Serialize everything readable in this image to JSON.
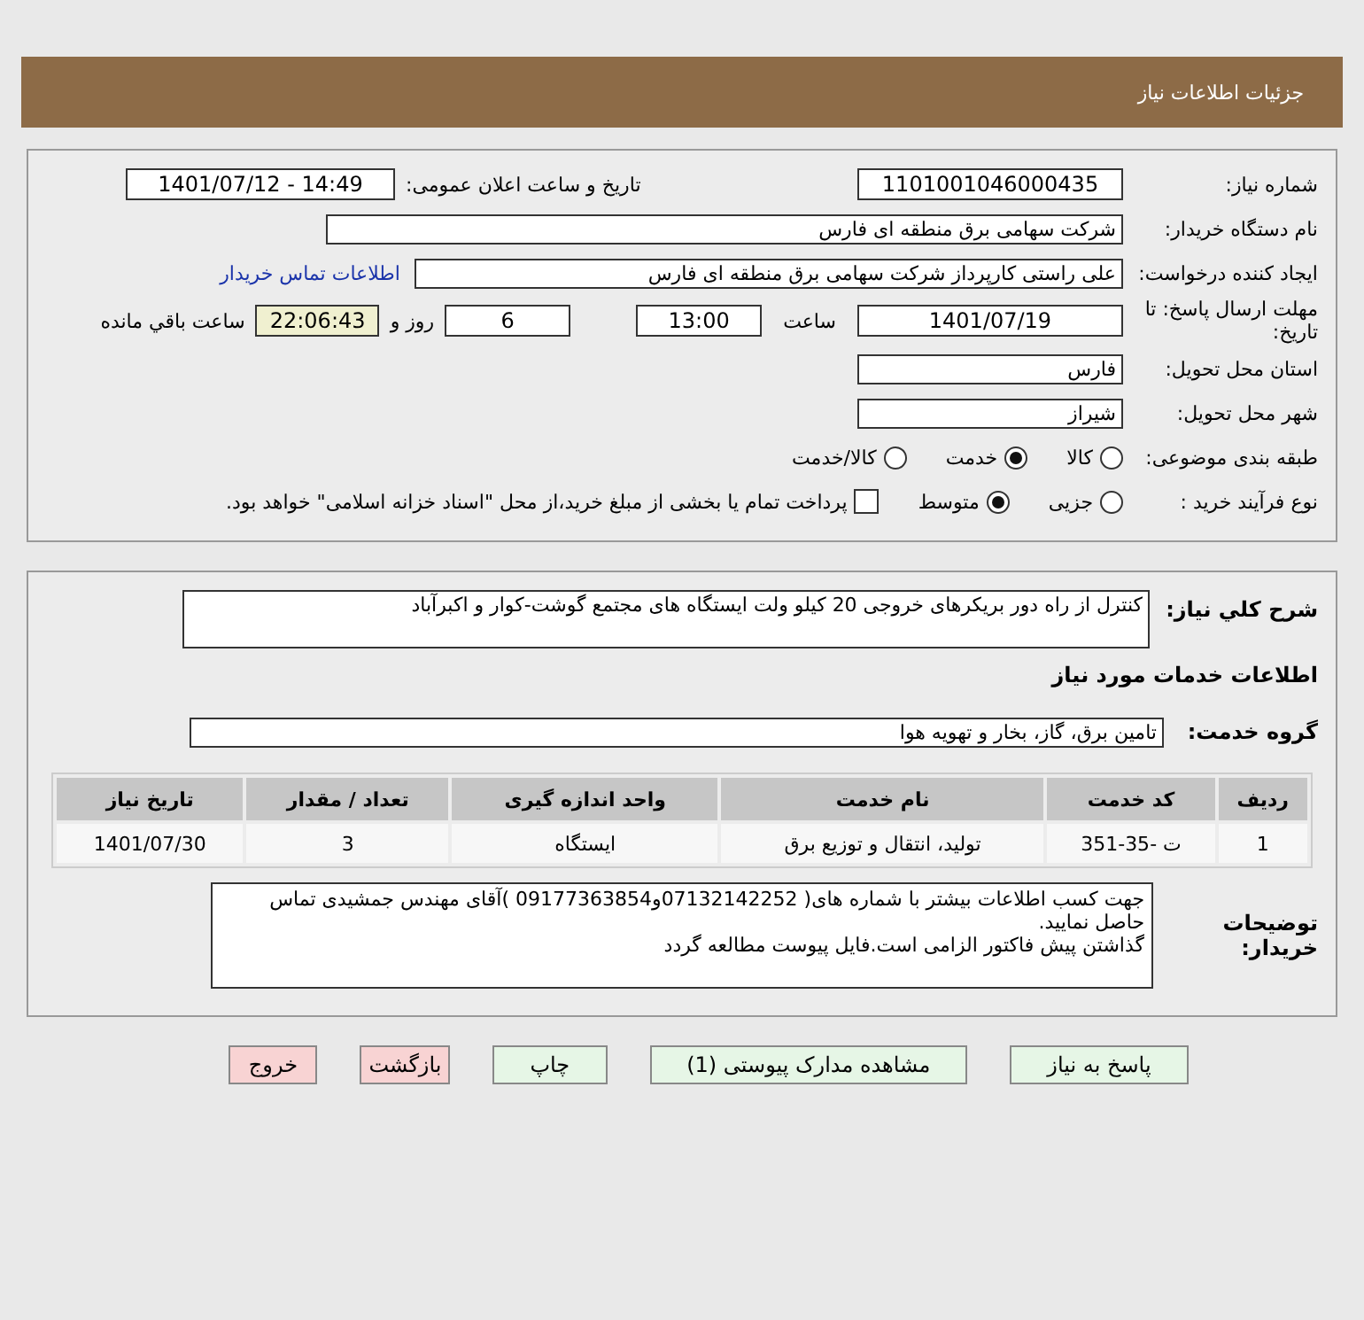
{
  "header": {
    "title": "جزئیات اطلاعات نیاز"
  },
  "details": {
    "need_number": {
      "label": "شماره نیاز:",
      "value": "1101001046000435"
    },
    "announce": {
      "label": "تاریخ و ساعت اعلان عمومی:",
      "value": "1401/07/12 - 14:49"
    },
    "buyer_org": {
      "label": "نام دستگاه خریدار:",
      "value": "شرکت سهامی برق منطقه ای فارس"
    },
    "requester": {
      "label": "ایجاد کننده درخواست:",
      "value": "علی راستی کارپرداز شرکت سهامی برق منطقه ای فارس"
    },
    "contact_link": "اطلاعات تماس خریدار",
    "deadline": {
      "label": "مهلت ارسال پاسخ: تا تاریخ:",
      "date": "1401/07/19",
      "time_label": "ساعت",
      "time": "13:00",
      "days": "6",
      "days_label": "روز و",
      "remaining": "22:06:43",
      "remaining_label": "ساعت باقي مانده"
    },
    "province": {
      "label": "استان محل تحویل:",
      "value": "فارس"
    },
    "city": {
      "label": "شهر محل تحویل:",
      "value": "شیراز"
    },
    "category": {
      "label": "طبقه بندی موضوعی:",
      "options": [
        {
          "label": "کالا",
          "selected": false
        },
        {
          "label": "خدمت",
          "selected": true
        },
        {
          "label": "کالا/خدمت",
          "selected": false
        }
      ]
    },
    "purchase_type": {
      "label": "نوع فرآیند خرید :",
      "options": [
        {
          "label": "جزیی",
          "selected": false
        },
        {
          "label": "متوسط",
          "selected": true
        }
      ],
      "treasury": {
        "label": "پرداخت تمام یا بخشی از مبلغ خرید،از محل \"اسناد خزانه اسلامی\" خواهد بود.",
        "checked": false
      }
    }
  },
  "services": {
    "description": {
      "label": "شرح کلي نیاز:",
      "value": "کنترل از راه دور بریکرهای خروجی 20 کیلو ولت ایستگاه های مجتمع گوشت-کوار و اکبرآباد"
    },
    "heading": "اطلاعات خدمات مورد نیاز",
    "group": {
      "label": "گروه خدمت:",
      "value": "تامین برق، گاز، بخار و تهویه هوا"
    },
    "table": {
      "columns": [
        "ردیف",
        "کد خدمت",
        "نام خدمت",
        "واحد اندازه گیری",
        "تعداد / مقدار",
        "تاریخ نیاز"
      ],
      "rows": [
        [
          "1",
          "ت -35-351",
          "تولید، انتقال و توزیع برق",
          "ایستگاه",
          "3",
          "1401/07/30"
        ]
      ]
    },
    "notes": {
      "label": "توضیحات خریدار:",
      "lines": [
        "جهت کسب اطلاعات بیشتر با شماره های( 07132142252و09177363854 )آقای مهندس جمشیدی تماس حاصل نمایید.",
        "گذاشتن پیش فاکتور الزامی است.فایل پیوست مطالعه گردد"
      ]
    }
  },
  "buttons": [
    {
      "label": "پاسخ به نیاز",
      "kind": "normal"
    },
    {
      "label": "مشاهده مدارک پیوستی (1)",
      "kind": "normal"
    },
    {
      "label": "چاپ",
      "kind": "normal"
    },
    {
      "label": "بازگشت",
      "kind": "danger"
    },
    {
      "label": "خروج",
      "kind": "danger"
    }
  ]
}
